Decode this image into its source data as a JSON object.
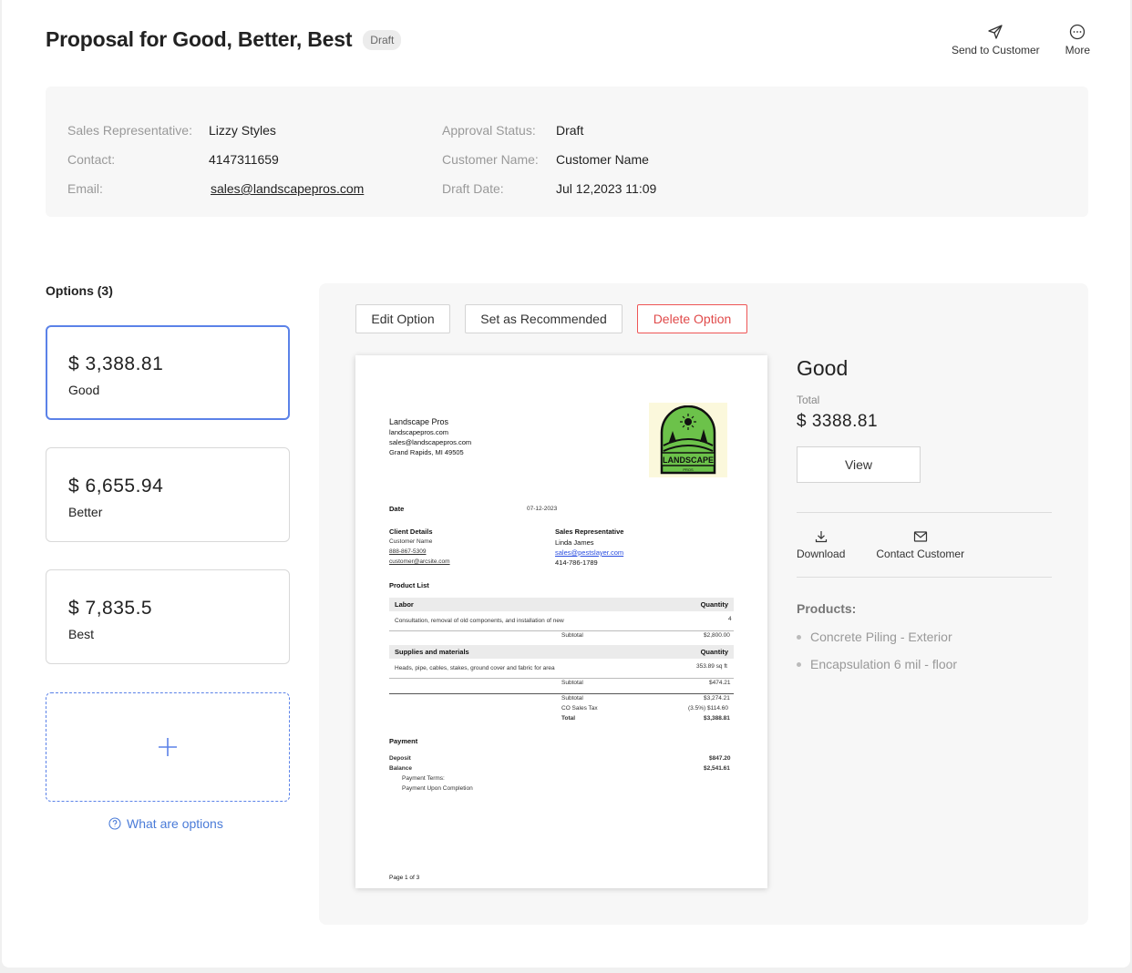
{
  "header": {
    "title": "Proposal for Good, Better, Best",
    "status_badge": "Draft",
    "actions": [
      {
        "label": "Send to Customer",
        "icon": "send-icon"
      },
      {
        "label": "More",
        "icon": "more-icon"
      }
    ]
  },
  "info": {
    "sales_rep_label": "Sales Representative:",
    "sales_rep": "Lizzy Styles",
    "contact_label": "Contact:",
    "contact": "4147311659",
    "email_label": "Email:",
    "email": "sales@landscapepros.com",
    "approval_label": "Approval Status:",
    "approval": "Draft",
    "customer_label": "Customer Name:",
    "customer": "Customer Name",
    "draft_date_label": "Draft Date:",
    "draft_date": "Jul 12,2023 11:09"
  },
  "options": {
    "title": "Options (3)",
    "items": [
      {
        "price": "$ 3,388.81",
        "name": "Good",
        "selected": true
      },
      {
        "price": "$ 6,655.94",
        "name": "Better",
        "selected": false
      },
      {
        "price": "$ 7,835.5",
        "name": "Best",
        "selected": false
      }
    ],
    "help_link": "What are options"
  },
  "toolbar": {
    "edit": "Edit Option",
    "recommend": "Set as Recommended",
    "delete": "Delete Option"
  },
  "document": {
    "company": "Landscape Pros",
    "website": "landscapepros.com",
    "email": "sales@landscapepros.com",
    "address": "Grand Rapids, MI 49505",
    "logo_text": "LANDSCAPE",
    "logo_sub": "PROS",
    "date_label": "Date",
    "date": "07-12-2023",
    "client_title": "Client Details",
    "client_name": "Customer Name",
    "client_phone": "888-867-5309",
    "client_email": "customer@arcsite.com",
    "rep_title": "Sales Representative",
    "rep_name": "Linda James",
    "rep_email": "sales@pestslayer.com",
    "rep_phone": "414-786-1789",
    "product_list": "Product List",
    "labor_header": "Labor",
    "qty_header": "Quantity",
    "labor_desc": "Consultation, removal of old components, and installation of new",
    "labor_qty": "4",
    "subtotal_label": "Subtotal",
    "labor_subtotal": "$2,800.00",
    "supplies_header": "Supplies and materials",
    "supplies_desc": "Heads, pipe, cables, stakes, ground cover and fabric for area",
    "supplies_qty": "353.89 sq ft",
    "supplies_subtotal": "$474.21",
    "sum_subtotal": "$3,274.21",
    "tax_label": "CO Sales Tax",
    "tax": "(3.5%) $114.60",
    "total_label": "Total",
    "total": "$3,388.81",
    "payment_title": "Payment",
    "deposit_label": "Deposit",
    "deposit": "$847.20",
    "balance_label": "Balance",
    "balance": "$2,541.61",
    "terms_label": "Payment Terms:",
    "terms": "Payment Upon Completion",
    "page": "Page 1 of 3"
  },
  "detail": {
    "name": "Good",
    "total_label": "Total",
    "total": "$ 3388.81",
    "view": "View",
    "download": "Download",
    "contact": "Contact Customer",
    "products_title": "Products:",
    "products": [
      "Concrete Piling - Exterior",
      "Encapsulation 6 mil - floor"
    ]
  },
  "colors": {
    "accent": "#5b82e8",
    "link": "#4a7bd8",
    "danger": "#e04a4a",
    "logo_green": "#6cc24a"
  }
}
